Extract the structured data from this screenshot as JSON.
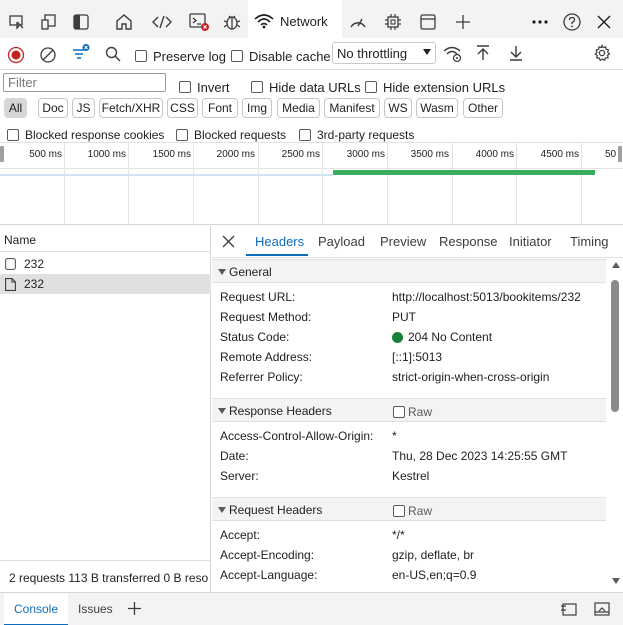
{
  "topbar": {
    "network_label": "Network",
    "icons": [
      "inspect-icon",
      "device-emulation-icon",
      "dock-icon",
      "welcome-home-icon",
      "elements-icon",
      "console-icon",
      "sources-bug-icon",
      "network-wifi-icon",
      "performance-icon",
      "memory-icon",
      "application-icon",
      "add-tool-icon",
      "more-icon",
      "help-icon",
      "close-icon"
    ]
  },
  "toolbar": {
    "preserve_log": "Preserve log",
    "disable_cache": "Disable cache",
    "throttling": "No throttling"
  },
  "filter": {
    "placeholder": "Filter",
    "invert": "Invert",
    "hide_data_urls": "Hide data URLs",
    "hide_extension_urls": "Hide extension URLs"
  },
  "types": [
    "All",
    "Doc",
    "JS",
    "Fetch/XHR",
    "CSS",
    "Font",
    "Img",
    "Media",
    "Manifest",
    "WS",
    "Wasm",
    "Other"
  ],
  "blocked": {
    "blocked_cookies": "Blocked response cookies",
    "blocked_requests": "Blocked requests",
    "third_party": "3rd-party requests"
  },
  "timeline": {
    "ticks": [
      "500 ms",
      "1000 ms",
      "1500 ms",
      "2000 ms",
      "2500 ms",
      "3000 ms",
      "3500 ms",
      "4000 ms",
      "4500 ms",
      "50"
    ]
  },
  "requests": {
    "header": "Name",
    "rows": [
      {
        "name": "232"
      },
      {
        "name": "232"
      }
    ],
    "summary": "2 requests  113 B transferred  0 B reso"
  },
  "details": {
    "tabs": [
      "Headers",
      "Payload",
      "Preview",
      "Response",
      "Initiator",
      "Timing"
    ],
    "general": {
      "title": "General",
      "request_url_k": "Request URL:",
      "request_url_v": "http://localhost:5013/bookitems/232",
      "method_k": "Request Method:",
      "method_v": "PUT",
      "status_k": "Status Code:",
      "status_v": "204 No Content",
      "remote_k": "Remote Address:",
      "remote_v": "[::1]:5013",
      "referrer_k": "Referrer Policy:",
      "referrer_v": "strict-origin-when-cross-origin"
    },
    "response_headers": {
      "title": "Response Headers",
      "raw": "Raw",
      "acao_k": "Access-Control-Allow-Origin:",
      "acao_v": "*",
      "date_k": "Date:",
      "date_v": "Thu, 28 Dec 2023 14:25:55 GMT",
      "server_k": "Server:",
      "server_v": "Kestrel"
    },
    "request_headers": {
      "title": "Request Headers",
      "raw": "Raw",
      "accept_k": "Accept:",
      "accept_v": "*/*",
      "encoding_k": "Accept-Encoding:",
      "encoding_v": "gzip, deflate, br",
      "language_k": "Accept-Language:",
      "language_v": "en-US,en;q=0.9"
    }
  },
  "drawer": {
    "console": "Console",
    "issues": "Issues"
  },
  "colors": {
    "accent": "#0f6cbd",
    "record_red": "#c5221f",
    "status_green": "#188038",
    "timeline_green": "#3aad5e"
  }
}
